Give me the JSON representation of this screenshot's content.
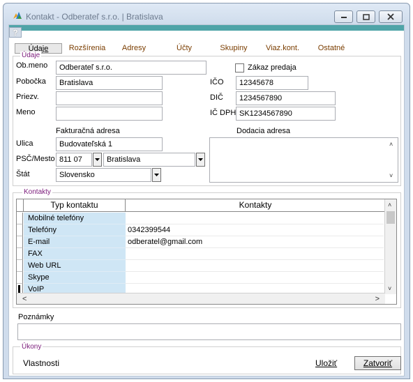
{
  "window": {
    "title": "Kontakt - Odberateľ s.r.o. | Bratislava"
  },
  "help_label": "?",
  "tabs": [
    {
      "label": "Údaje",
      "active": true
    },
    {
      "label": "Rozšírenia"
    },
    {
      "label": "Adresy"
    },
    {
      "label": "Účty"
    },
    {
      "label": "Skupiny"
    },
    {
      "label": "Viaz.kont."
    },
    {
      "label": "Ostatné"
    }
  ],
  "udaje": {
    "group_label": "Údaje",
    "ob_meno_label": "Ob.meno",
    "ob_meno_value": "Odberateľ s.r.o.",
    "pobocka_label": "Pobočka",
    "pobocka_value": "Bratislava",
    "priezv_label": "Priezv.",
    "priezv_value": "",
    "meno_label": "Meno",
    "meno_value": "",
    "zakaz_predaja_label": "Zákaz predaja",
    "ico_label": "IČO",
    "ico_value": "12345678",
    "dic_label": "DIČ",
    "dic_value": "1234567890",
    "ic_dph_label": "IČ DPH",
    "ic_dph_value": "SK1234567890",
    "fakturacna_label": "Fakturačná adresa",
    "dodacia_label": "Dodacia adresa",
    "ulica_label": "Ulica",
    "ulica_value": "Budovateľská 1",
    "psc_label": "PSČ/Mesto",
    "psc_value": "811 07",
    "mesto_value": "Bratislava",
    "stat_label": "Štát",
    "stat_value": "Slovensko"
  },
  "kontakty": {
    "group_label": "Kontakty",
    "col_type": "Typ kontaktu",
    "col_value": "Kontakty",
    "rows": [
      {
        "type": "Mobilné telefóny",
        "value": ""
      },
      {
        "type": "Telefóny",
        "value": "0342399544"
      },
      {
        "type": "E-mail",
        "value": "odberatel@gmail.com"
      },
      {
        "type": "FAX",
        "value": ""
      },
      {
        "type": "Web URL",
        "value": ""
      },
      {
        "type": "Skype",
        "value": ""
      },
      {
        "type": "VoIP",
        "value": ""
      }
    ]
  },
  "poznamky_label": "Poznámky",
  "ukony": {
    "group_label": "Úkony",
    "vlastnosti": "Vlastnosti",
    "ulozit": "Uložiť",
    "zatvorit": "Zatvoriť"
  }
}
